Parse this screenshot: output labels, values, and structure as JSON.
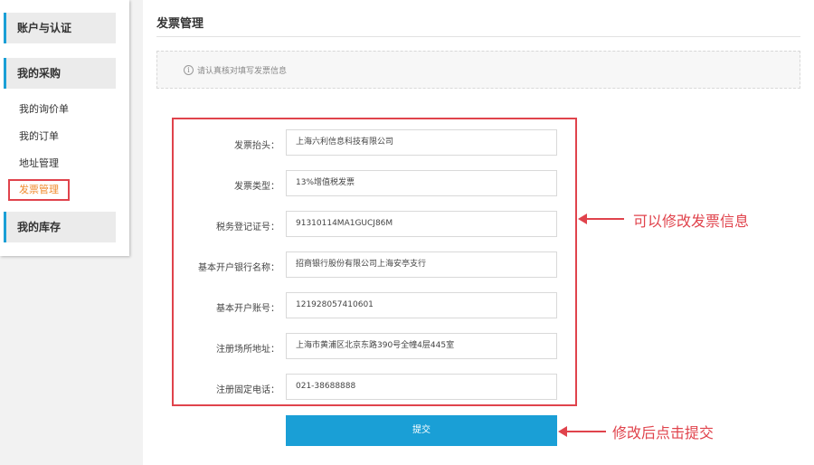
{
  "sidebar": {
    "sections": [
      {
        "title": "账户与认证"
      },
      {
        "title": "我的采购"
      },
      {
        "title": "我的库存"
      }
    ],
    "items": [
      {
        "label": "我的询价单"
      },
      {
        "label": "我的订单"
      },
      {
        "label": "地址管理"
      },
      {
        "label": "发票管理"
      }
    ]
  },
  "main": {
    "title": "发票管理",
    "notice": "请认真核对填写发票信息",
    "fields": [
      {
        "label": "发票抬头：",
        "value": "上海六利信息科技有限公司"
      },
      {
        "label": "发票类型：",
        "value": "13%增值税发票"
      },
      {
        "label": "税务登记证号：",
        "value": "91310114MA1GUCJ86M"
      },
      {
        "label": "基本开户银行名称：",
        "value": "招商银行股份有限公司上海安亭支行"
      },
      {
        "label": "基本开户账号：",
        "value": "121928057410601"
      },
      {
        "label": "注册场所地址：",
        "value": "上海市黄浦区北京东路390号全幢4层445室"
      },
      {
        "label": "注册固定电话：",
        "value": "021-38688888"
      }
    ],
    "submit_label": "提交"
  },
  "annotations": {
    "edit_hint": "可以修改发票信息",
    "submit_hint": "修改后点击提交"
  },
  "colors": {
    "accent": "#1a9fd6",
    "highlight": "#e0434c",
    "active_text": "#f08a2c"
  }
}
